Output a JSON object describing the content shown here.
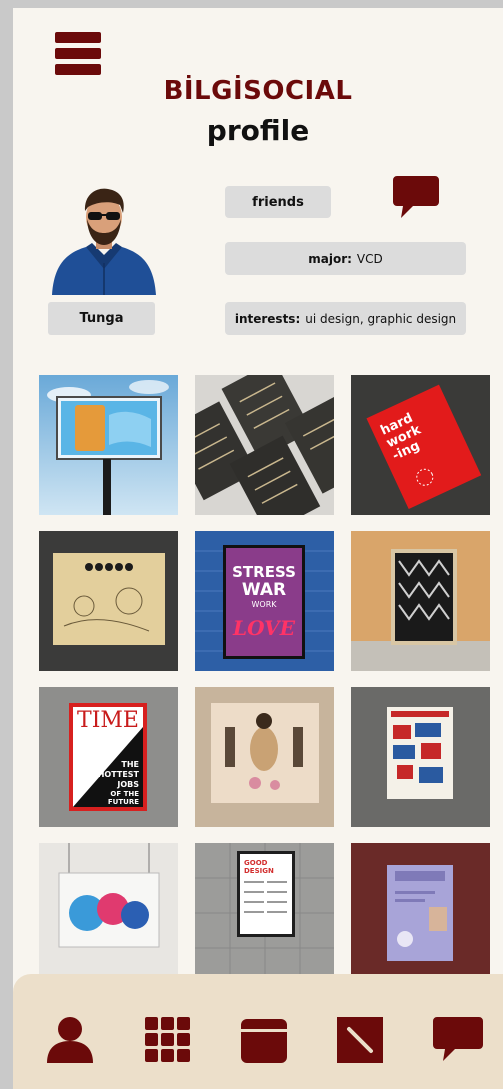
{
  "header": {
    "brand": "BİLGİSOCIAL",
    "page_title": "profile"
  },
  "profile": {
    "name": "Tunga",
    "friends_label": "friends",
    "major_label": "major:",
    "major_value": "VCD",
    "interests_label": "interests:",
    "interests_value": "ui design, graphic design"
  },
  "colors": {
    "accent": "#6b0a0a",
    "background": "#f8f5ef",
    "pill": "#dcdcdc",
    "nav_bg": "#ecdfca"
  },
  "icons": {
    "menu": "hamburger-icon",
    "chat": "chat-bubble-icon",
    "nav": [
      "profile-icon",
      "grid-icon",
      "calendar-icon",
      "edit-icon",
      "messages-icon"
    ]
  },
  "gallery": {
    "tiles": [
      {
        "texts": []
      },
      {
        "texts": []
      },
      {
        "texts": [
          "hard",
          "work",
          "-ing"
        ]
      },
      {
        "texts": []
      },
      {
        "texts": [
          "STRESS",
          "WAR",
          "WORK",
          "LOVE"
        ]
      },
      {
        "texts": []
      },
      {
        "texts": [
          "TIME",
          "THE",
          "HOTTEST",
          "JOBS",
          "OF THE",
          "FUTURE"
        ]
      },
      {
        "texts": []
      },
      {
        "texts": []
      },
      {
        "texts": []
      },
      {
        "texts": [
          "GOOD",
          "DESIGN"
        ]
      },
      {
        "texts": []
      }
    ]
  }
}
